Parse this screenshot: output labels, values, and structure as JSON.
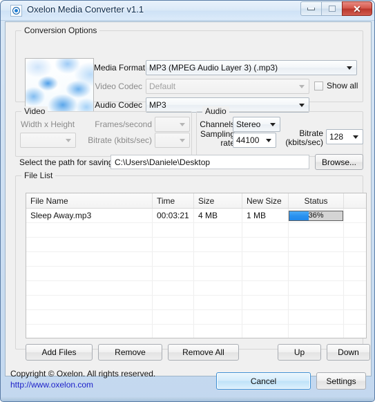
{
  "window": {
    "title": "Oxelon Media Converter v1.1",
    "icon": "app-logo-icon",
    "controls": {
      "minimize": "–",
      "maximize": "□",
      "close": "✕"
    }
  },
  "conversion_options": {
    "legend": "Conversion Options",
    "media_format_label": "Media Format",
    "media_format_value": "MP3 (MPEG Audio Layer 3) (.mp3)",
    "video_codec_label": "Video Codec",
    "video_codec_value": "Default",
    "audio_codec_label": "Audio Codec",
    "audio_codec_value": "MP3",
    "show_all_label": "Show all",
    "show_all_checked": false
  },
  "video": {
    "legend": "Video",
    "width_height_label": "Width x Height",
    "width_height_value": "",
    "frames_label": "Frames/second",
    "frames_value": "",
    "bitrate_label": "Bitrate (kbits/sec)",
    "bitrate_value": ""
  },
  "audio": {
    "legend": "Audio",
    "channels_label": "Channels",
    "channels_value": "Stereo",
    "sampling_label_line1": "Sampling",
    "sampling_label_line2": "rate",
    "sampling_value": "44100",
    "bitrate_label_line1": "Bitrate",
    "bitrate_label_line2": "(kbits/sec)",
    "bitrate_value": "128"
  },
  "save_path": {
    "label": "Select the path for saving:",
    "value": "C:\\Users\\Daniele\\Desktop",
    "browse_label": "Browse..."
  },
  "file_list": {
    "legend": "File List",
    "columns": [
      "File Name",
      "Time",
      "Size",
      "New Size",
      "Status",
      ""
    ],
    "rows": [
      {
        "file_name": "Sleep Away.mp3",
        "time": "00:03:21",
        "size": "4 MB",
        "new_size": "1 MB",
        "status_percent": 36,
        "status_text": "36%"
      }
    ],
    "buttons": {
      "add_files": "Add Files",
      "remove": "Remove",
      "remove_all": "Remove All",
      "up": "Up",
      "down": "Down"
    }
  },
  "footer": {
    "copyright": "Copyright © Oxelon. All rights reserved.",
    "website": "http://www.oxelon.com",
    "cancel_label": "Cancel",
    "settings_label": "Settings"
  },
  "colors": {
    "accent_blue": "#2a92ef",
    "link_blue": "#1b1ec8",
    "close_red": "#b9362b"
  }
}
